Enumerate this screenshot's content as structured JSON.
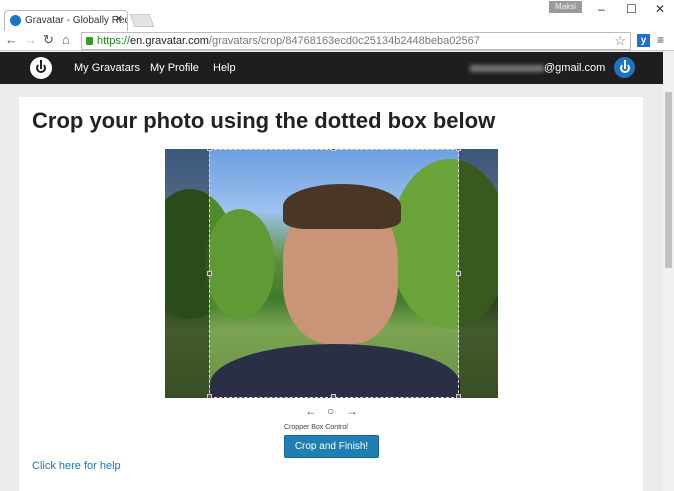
{
  "browser": {
    "tab_title": "Gravatar - Globally Recog",
    "user": "Maksi",
    "url_scheme": "https://",
    "url_domain": "en.gravatar.com",
    "url_path": "/gravatars/crop/84768163ecd0c25134b2448beba02567"
  },
  "nav": {
    "items": [
      "My Gravatars",
      "My Profile",
      "Help"
    ],
    "email_suffix": "@gmail.com"
  },
  "main": {
    "title": "Crop your photo using the dotted box below",
    "left_arrow": "←",
    "center": "○",
    "right_arrow": "→",
    "cropper_label": "Cropper Box Control",
    "button": "Crop and Finish!",
    "help_link": "Click here for help"
  },
  "colors": {
    "nav_bg": "#1e1e1e",
    "accent": "#1e73be",
    "button": "#1f7fb3"
  }
}
